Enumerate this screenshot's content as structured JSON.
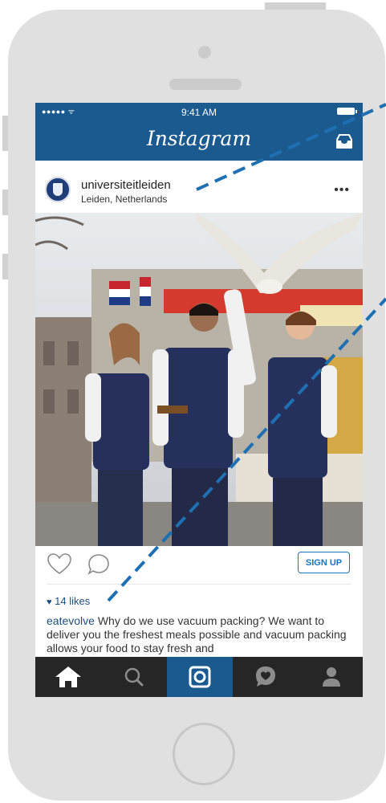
{
  "status_bar": {
    "carrier": "●●●●● ᯤ",
    "time": "9:41 AM"
  },
  "navbar": {
    "title": "Instagram",
    "inbox_icon": "inbox-tray-icon"
  },
  "post": {
    "username": "universiteitleiden",
    "location": "Leiden, Netherlands",
    "more": "•••",
    "likes_heart": "♥",
    "likes": "14 likes",
    "caption_user": "eatevolve",
    "caption_text": " Why do we use vacuum packing? We want to deliver you the freshest meals possible and vacuum packing allows your food to stay fresh and"
  },
  "actions": {
    "signup_label": "SIGN UP"
  },
  "tabs": [
    {
      "name": "home-icon"
    },
    {
      "name": "search-icon"
    },
    {
      "name": "camera-icon"
    },
    {
      "name": "activity-icon"
    },
    {
      "name": "profile-icon"
    }
  ],
  "colors": {
    "brand_blue": "#1a5a8e",
    "link_blue": "#1a73c1",
    "tab_bar": "#262626",
    "annotation_dash": "#1f6fb3"
  }
}
